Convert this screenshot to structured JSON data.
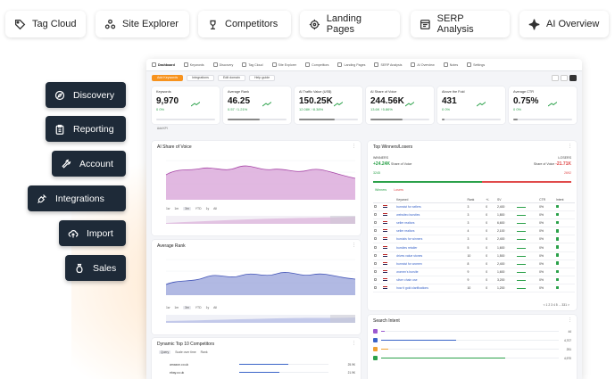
{
  "features": [
    {
      "label": "Tag Cloud",
      "icon": "tag-icon"
    },
    {
      "label": "Site Explorer",
      "icon": "site-explorer-icon"
    },
    {
      "label": "Competitors",
      "icon": "competitors-icon"
    },
    {
      "label": "Landing Pages",
      "icon": "target-icon"
    },
    {
      "label": "SERP Analysis",
      "icon": "serp-window-icon"
    },
    {
      "label": "AI Overview",
      "icon": "sparkle-icon"
    }
  ],
  "side_menu": [
    {
      "label": "Discovery",
      "icon": "compass-icon"
    },
    {
      "label": "Reporting",
      "icon": "clipboard-icon"
    },
    {
      "label": "Account",
      "icon": "wrench-icon"
    },
    {
      "label": "Integrations",
      "icon": "plug-icon"
    },
    {
      "label": "Import",
      "icon": "cloud-upload-icon"
    },
    {
      "label": "Sales",
      "icon": "money-bag-icon"
    }
  ],
  "dashboard": {
    "nav_tabs": [
      "Dashboard",
      "Keywords",
      "Discovery",
      "Tag Cloud",
      "Site Explorer",
      "Competitors",
      "Landing Pages",
      "SERP Analysis",
      "AI Overview",
      "Notes",
      "Settings"
    ],
    "toolbar": {
      "add_keywords": "Add Keywords",
      "integrations": "Integrations",
      "edit_domain": "Edit domain",
      "help_guide": "Help guide"
    },
    "kpis": [
      {
        "label": "Keywords",
        "value": "9,970",
        "delta": "0 0%",
        "bar_fraction": 0.0
      },
      {
        "label": "Average Rank",
        "value": "46.25",
        "delta": "0.57 ↑1.21%",
        "bar_fraction": 0.55
      },
      {
        "label": "AI Traffic Value (US$)",
        "value": "150.25K",
        "delta": "12.08K ↑8.38%",
        "bar_fraction": 0.6
      },
      {
        "label": "AI Share of Voice",
        "value": "244.56K",
        "delta": "13.6K ↑5.86%",
        "bar_fraction": 0.55
      },
      {
        "label": "Above the Fold",
        "value": "431",
        "delta": "0 0%",
        "bar_fraction": 0.05
      },
      {
        "label": "Average CTR",
        "value": "0.75%",
        "delta": "0 0%",
        "bar_fraction": 0.08
      }
    ],
    "add_kpi": "Add KPI",
    "share_of_voice": {
      "title": "AI Share of Voice",
      "ranges": [
        "1w",
        "1m",
        "3m",
        "YTD",
        "1y",
        "All"
      ],
      "selected_range": "3m"
    },
    "average_rank": {
      "title": "Average Rank",
      "ranges": [
        "1w",
        "1m",
        "3m",
        "YTD",
        "1y",
        "All"
      ],
      "selected_range": "3m"
    },
    "competitors": {
      "title": "Dynamic Top 10 Competitors",
      "tabs": [
        "Query",
        "Scale over time",
        "Rank"
      ],
      "rows": [
        {
          "name": "amazon.co.uk",
          "value": "25.9K",
          "fraction": 0.55
        },
        {
          "name": "ebay.co.uk",
          "value": "21.9K",
          "fraction": 0.45
        }
      ]
    },
    "winners_losers": {
      "title": "Top Winners/Losers",
      "winners_label": "WINNERS",
      "losers_label": "LOSERS",
      "winners_sov": "+24.24K",
      "losers_sov": "-21.71K",
      "sov_caption": "Share of Voice",
      "winners_count": "3245",
      "losers_count": "2692",
      "tabs": [
        "Winners",
        "Losers"
      ],
      "columns": [
        "",
        "",
        "Keyword",
        "Rank",
        "+/-",
        "SV",
        "",
        "CTR",
        "Intent"
      ],
      "rows": [
        {
          "keyword": "burnsist for sellers",
          "rank": "3",
          "change": "0",
          "sv": "2,400",
          "ctr": "0%"
        },
        {
          "keyword": "websiteo bursties",
          "rank": "3",
          "change": "0",
          "sv": "1,800",
          "ctr": "0%"
        },
        {
          "keyword": "seller realtors",
          "rank": "3",
          "change": "0",
          "sv": "6,600",
          "ctr": "0%"
        },
        {
          "keyword": "seller realtors",
          "rank": "4",
          "change": "0",
          "sv": "2,100",
          "ctr": "0%"
        },
        {
          "keyword": "bursists for winners",
          "rank": "3",
          "change": "0",
          "sv": "2,400",
          "ctr": "0%"
        },
        {
          "keyword": "bursites retailer",
          "rank": "5",
          "change": "0",
          "sv": "1,600",
          "ctr": "0%"
        },
        {
          "keyword": "drives value stones",
          "rank": "10",
          "change": "0",
          "sv": "1,500",
          "ctr": "0%"
        },
        {
          "keyword": "burnsist for women",
          "rank": "8",
          "change": "0",
          "sv": "2,400",
          "ctr": "0%"
        },
        {
          "keyword": "women's bursite",
          "rank": "9",
          "change": "0",
          "sv": "1,600",
          "ctr": "0%"
        },
        {
          "keyword": "silver chain use",
          "rank": "9",
          "change": "0",
          "sv": "3,200",
          "ctr": "0%"
        },
        {
          "keyword": "how it gold clarifications",
          "rank": "10",
          "change": "0",
          "sv": "1,200",
          "ctr": "0%"
        }
      ],
      "pager": "< 1 2 3 4 5 ... 331 >"
    },
    "search_intent": {
      "title": "Search Intent",
      "rows": [
        {
          "badge": "I",
          "color": "#9b59d0",
          "fraction": 0.02,
          "value": "44"
        },
        {
          "badge": "C",
          "color": "#3a64c8",
          "fraction": 0.42,
          "value": "4,707"
        },
        {
          "badge": "T",
          "color": "#f0a030",
          "fraction": 0.04,
          "value": "251"
        },
        {
          "badge": "N",
          "color": "#2ba14a",
          "fraction": 0.7,
          "value": "4,970"
        }
      ]
    }
  }
}
